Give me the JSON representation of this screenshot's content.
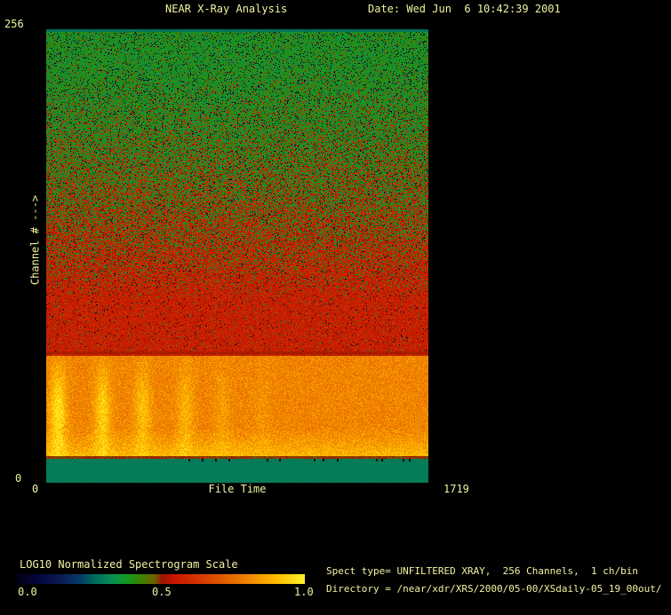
{
  "window": {
    "background": "#000000",
    "text_color": "#f2f2a2"
  },
  "header": {
    "title": "NEAR X-Ray Analysis",
    "date": "Date: Wed Jun  6 10:42:39 2001"
  },
  "plot": {
    "y_axis": {
      "title": "Channel # --->",
      "max_label": "256",
      "min_label": "0"
    },
    "x_axis": {
      "title": "File Time",
      "min_label": "0",
      "max_label": "1719"
    }
  },
  "colorbar": {
    "title": "LOG10 Normalized Spectrogram Scale",
    "tick_labels": [
      "0.0",
      "0.5",
      "1.0"
    ]
  },
  "info": {
    "spect_line": "Spect type= UNFILTERED XRAY,  256 Channels,  1 ch/bin",
    "directory_line": "Directory = /near/xdr/XRS/2000/05-00/XSdaily-05_19_00out/"
  },
  "chart_data": {
    "type": "heatmap",
    "title": "NEAR X-Ray Analysis",
    "xlabel": "File Time",
    "ylabel": "Channel # --->",
    "x_range": [
      0,
      1719
    ],
    "y_range": [
      0,
      256
    ],
    "value_scale_label": "LOG10 Normalized Spectrogram Scale",
    "value_range": [
      0.0,
      1.0
    ],
    "colorbar_ticks": [
      0.0,
      0.5,
      1.0
    ],
    "colormap_stops": [
      {
        "pos": 0.0,
        "color": "#010112"
      },
      {
        "pos": 0.08,
        "color": "#03063e"
      },
      {
        "pos": 0.16,
        "color": "#0a1c55"
      },
      {
        "pos": 0.22,
        "color": "#063a66"
      },
      {
        "pos": 0.28,
        "color": "#00705c"
      },
      {
        "pos": 0.34,
        "color": "#0a9150"
      },
      {
        "pos": 0.38,
        "color": "#0f9a22"
      },
      {
        "pos": 0.44,
        "color": "#427f00"
      },
      {
        "pos": 0.48,
        "color": "#6e6000"
      },
      {
        "pos": 0.505,
        "color": "#9c1400"
      },
      {
        "pos": 0.55,
        "color": "#c81800"
      },
      {
        "pos": 0.66,
        "color": "#d84000"
      },
      {
        "pos": 0.8,
        "color": "#f08200"
      },
      {
        "pos": 0.91,
        "color": "#ffc000"
      },
      {
        "pos": 1.0,
        "color": "#fff22a"
      }
    ],
    "regions": [
      {
        "name": "top-teal-line",
        "channels": [
          254.5,
          256
        ],
        "mode": "solid",
        "value": 0.285,
        "noise": 0.012
      },
      {
        "name": "green-to-red-noise",
        "channels": [
          74,
          254.5
        ],
        "mode": "bimodal",
        "green_value": 0.4,
        "red_value": 0.565,
        "value_noise": 0.05,
        "red_fraction": [
          0.035,
          0.975
        ],
        "black_speck_value": 0.015,
        "black_speck_prob": [
          0.08,
          0.015
        ],
        "blue_speck_value": 0.17,
        "blue_speck_prob": 0.012
      },
      {
        "name": "orange-band-top-edge",
        "channels": [
          72.5,
          74
        ],
        "mode": "solid",
        "value": 0.52,
        "noise": 0.03
      },
      {
        "name": "orange-band",
        "channels": [
          15.2,
          72.5
        ],
        "mode": "orange",
        "base_value": 0.8,
        "value_noise": 0.12,
        "bottom_boost": 0.09,
        "top_dark_rows": 2
      },
      {
        "name": "bottom-dark-edge",
        "channels": [
          13.3,
          15.2
        ],
        "mode": "solid",
        "value": 0.5,
        "noise": 0.04
      },
      {
        "name": "bottom-teal-band",
        "channels": [
          0,
          13.3
        ],
        "mode": "solid",
        "value": 0.3,
        "noise": 0.004,
        "tick_marks_x_time": [
          640,
          700,
          760,
          820,
          991,
          1047,
          1203,
          1243,
          1307,
          1483,
          1507,
          1603,
          1631
        ]
      }
    ],
    "streak_profile": {
      "center_channel": 40,
      "sigma_channels": 18,
      "sigma_time": 26
    },
    "streaks": [
      {
        "time": 52,
        "peak_value": 0.97
      },
      {
        "time": 252,
        "peak_value": 0.94
      },
      {
        "time": 432,
        "peak_value": 0.91
      },
      {
        "time": 624,
        "peak_value": 0.89
      },
      {
        "time": 792,
        "peak_value": 0.85
      },
      {
        "time": 971,
        "peak_value": 0.83
      }
    ]
  }
}
